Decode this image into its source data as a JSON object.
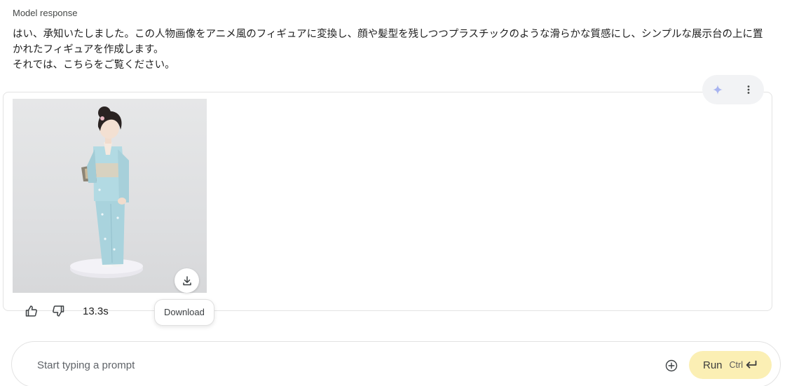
{
  "header": {
    "label": "Model response"
  },
  "response": {
    "lines": [
      "はい、承知いたしました。この人物画像をアニメ風のフィギュアに変換し、顔や髪型を残しつつプラスチックのような滑らかな質感にし、シンプルな展示台の上に置かれたフィギュアを作成します。",
      "それでは、こちらをご覧ください。"
    ]
  },
  "card": {
    "actions": [
      {
        "icon": "sparkle-icon",
        "color": "#a8b4f0"
      },
      {
        "icon": "more-vert-icon"
      }
    ],
    "image": {
      "description_icon": "generated-figure-image",
      "download_icon": "download-icon"
    },
    "tooltip": "Download"
  },
  "feedback": {
    "thumbs_up_icon": "thumb-up-icon",
    "thumbs_down_icon": "thumb-down-icon",
    "elapsed": "13.3s"
  },
  "prompt": {
    "placeholder": "Start typing a prompt",
    "add_icon": "add-circle-icon",
    "run_label": "Run",
    "run_shortcut": "Ctrl",
    "enter_icon": "enter-key-icon",
    "run_color": "#fbefb4"
  }
}
